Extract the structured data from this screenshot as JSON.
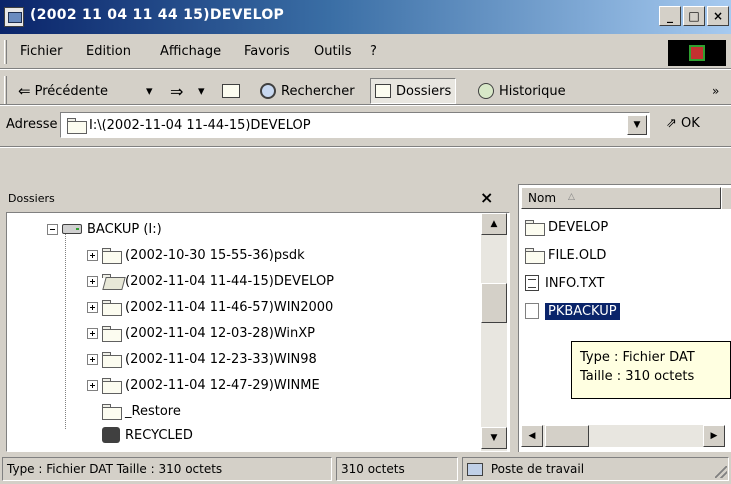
{
  "window": {
    "title": "(2002 11 04 11 44 15)DEVELOP",
    "min_glyph": "_",
    "max_glyph": "□",
    "close_glyph": "×"
  },
  "menu": {
    "items": [
      "Fichier",
      "Edition",
      "Affichage",
      "Favoris",
      "Outils",
      "?"
    ]
  },
  "toolbar": {
    "back": "Précédente",
    "back_arrow": "⇐",
    "dropdown": "▾",
    "forward_arrow": "⇒",
    "search": "Rechercher",
    "folders": "Dossiers",
    "history": "Historique",
    "more": "»"
  },
  "address": {
    "label": "Adresse",
    "value": "I:\\(2002-11-04 11-44-15)DEVELOP",
    "dropdown": "▼",
    "go": "OK",
    "go_arrow": "⇗"
  },
  "folders_pane": {
    "title": "Dossiers",
    "close": "×",
    "tree": [
      {
        "label": "BACKUP (I:)",
        "kind": "drive",
        "expander": "minus"
      },
      {
        "label": "(2002-10-30 15-55-36)psdk",
        "kind": "folder",
        "expander": "plus"
      },
      {
        "label": "(2002-11-04 11-44-15)DEVELOP",
        "kind": "folder-open",
        "expander": "plus"
      },
      {
        "label": "(2002-11-04 11-46-57)WIN2000",
        "kind": "folder",
        "expander": "plus"
      },
      {
        "label": "(2002-11-04 12-03-28)WinXP",
        "kind": "folder",
        "expander": "plus"
      },
      {
        "label": "(2002-11-04 12-23-33)WIN98",
        "kind": "folder",
        "expander": "plus"
      },
      {
        "label": "(2002-11-04 12-47-29)WINME",
        "kind": "folder",
        "expander": "plus"
      },
      {
        "label": "_Restore",
        "kind": "folder",
        "expander": "none"
      },
      {
        "label": "RECYCLED",
        "kind": "recycle",
        "expander": "none"
      }
    ],
    "scroll_up": "▲",
    "scroll_down": "▼"
  },
  "files_pane": {
    "column_name": "Nom",
    "sort_indicator": "△",
    "files": [
      {
        "name": "DEVELOP",
        "kind": "folder",
        "selected": false
      },
      {
        "name": "FILE.OLD",
        "kind": "folder",
        "selected": false
      },
      {
        "name": "INFO.TXT",
        "kind": "txt",
        "selected": false
      },
      {
        "name": "PKBACKUP",
        "kind": "dat",
        "selected": true
      }
    ],
    "tooltip": {
      "type_line": "Type : Fichier DAT",
      "size_line": "Taille  : 310 octets"
    },
    "scroll_left": "◀",
    "scroll_right": "▶"
  },
  "status": {
    "info": "Type : Fichier DAT Taille  : 310 octets",
    "size": "310 octets",
    "zone": "Poste de travail"
  }
}
